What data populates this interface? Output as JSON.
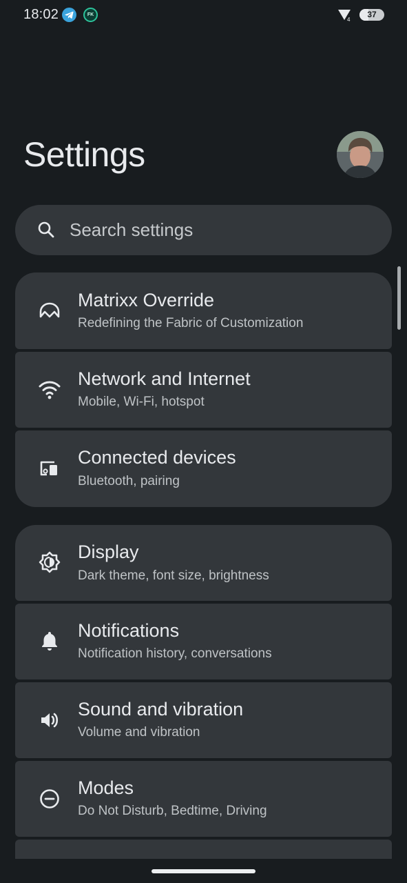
{
  "status_bar": {
    "time": "18:02",
    "notification_icons": [
      "telegram-icon",
      "fk-app-icon"
    ],
    "fk_label": "FK",
    "battery_level": "37",
    "battery_fraction": 0.37
  },
  "header": {
    "title": "Settings"
  },
  "search": {
    "placeholder": "Search settings",
    "value": ""
  },
  "settings_items": [
    {
      "icon": "matrixx-icon",
      "title": "Matrixx Override",
      "subtitle": "Redefining the Fabric of Customization"
    },
    {
      "icon": "wifi-icon",
      "title": "Network and Internet",
      "subtitle": "Mobile, Wi-Fi, hotspot"
    },
    {
      "icon": "connected-devices-icon",
      "title": "Connected devices",
      "subtitle": "Bluetooth, pairing"
    },
    {
      "icon": "display-icon",
      "title": "Display",
      "subtitle": "Dark theme, font size, brightness"
    },
    {
      "icon": "bell-icon",
      "title": "Notifications",
      "subtitle": "Notification history, conversations"
    },
    {
      "icon": "volume-icon",
      "title": "Sound and vibration",
      "subtitle": "Volume and vibration"
    },
    {
      "icon": "modes-icon",
      "title": "Modes",
      "subtitle": "Do Not Disturb, Bedtime, Driving"
    }
  ],
  "colors": {
    "background": "#181c1f",
    "card": "#33373b",
    "text_primary": "#e8eaed",
    "text_secondary": "#bfc3c6"
  }
}
